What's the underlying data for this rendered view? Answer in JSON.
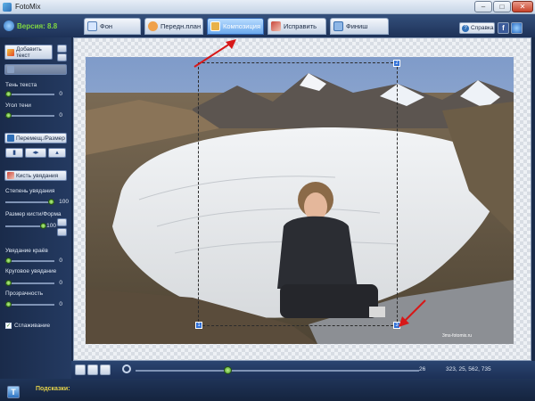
{
  "window": {
    "title": "FotoMix",
    "minimize": "–",
    "maximize": "□",
    "close": "✕"
  },
  "version": {
    "label": "Версия: 8.8"
  },
  "tabs": [
    {
      "label": "Фон",
      "icon": "background-icon",
      "color": "#d6e6ff"
    },
    {
      "label": "Передн.план",
      "icon": "foreground-icon",
      "color": "#f0a14a"
    },
    {
      "label": "Композиция",
      "icon": "composition-icon",
      "color": "#e8b24a",
      "active": true
    },
    {
      "label": "Исправить",
      "icon": "fix-brush-icon",
      "color": "#c9473b"
    },
    {
      "label": "Финиш",
      "icon": "finish-icon",
      "color": "#8fb7e6"
    }
  ],
  "top_right": {
    "help_label": "Справка",
    "help_glyph": "?",
    "facebook_glyph": "f"
  },
  "left_panel": {
    "add_text_label": "Добавить текст",
    "disabled_button_label": "",
    "text_shadow_label": "Тень текста",
    "text_shadow_value": "0",
    "shadow_angle_label": "Угол тени",
    "shadow_angle_value": "0",
    "move_resize_label": "Перемещ./Размер",
    "tool_glyphs": [
      "▮",
      "◂▸",
      "▴"
    ],
    "fade_brush_label": "Кисть увядания",
    "fade_degree_label": "Степень увядания",
    "fade_degree_value": "100",
    "brush_size_label": "Размер кисти/Форма",
    "brush_size_value": "100",
    "edge_fade_label": "Увядание краёв",
    "edge_fade_value": "0",
    "circular_fade_label": "Круговое увядание",
    "circular_fade_value": "0",
    "transparency_label": "Прозрачность",
    "transparency_value": "0",
    "smoothing_label": "Сглаживание",
    "smoothing_checked": "✓",
    "help_corner_glyph": "T"
  },
  "slider_levels": {
    "text_shadow": 0.0,
    "shadow_angle": 0.0,
    "fade_degree": 1.0,
    "brush_size": 1.0,
    "edge_fade": 0.0,
    "circular_fade": 0.0,
    "transparency": 0.0,
    "zoom": 0.32
  },
  "canvas": {
    "handle_labels": {
      "top_right": "2",
      "bottom_left": "1",
      "bottom_right": "3"
    },
    "watermark": "3ms-fotomix.ru"
  },
  "bottom": {
    "zoom_value": "26",
    "coords": "323, 25, 562, 735"
  },
  "status": {
    "hints_label": "Подсказки:"
  }
}
